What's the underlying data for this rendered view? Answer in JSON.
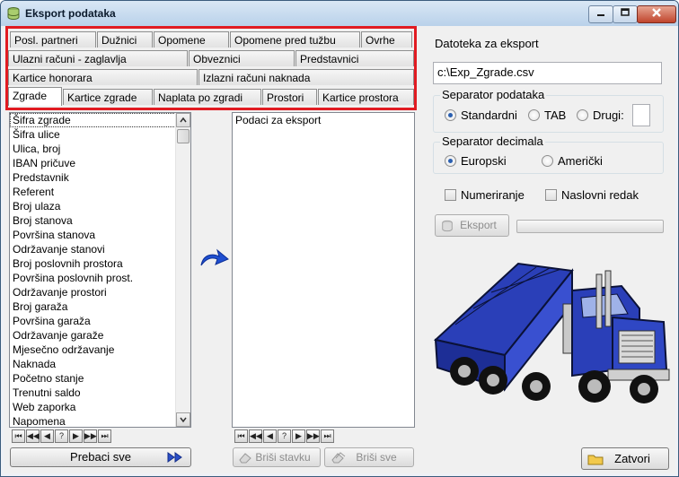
{
  "window": {
    "title": "Eksport podataka"
  },
  "tabs": {
    "row1": [
      "Posl. partneri",
      "Dužnici",
      "Opomene",
      "Opomene pred tužbu",
      "Ovrhe"
    ],
    "row2": [
      "Ulazni računi - zaglavlja",
      "Obveznici",
      "Predstavnici"
    ],
    "row3": [
      "Kartice honorara",
      "Izlazni računi naknada"
    ],
    "row4": [
      "Zgrade",
      "Kartice zgrade",
      "Naplata po zgradi",
      "Prostori",
      "Kartice prostora"
    ],
    "active": "Zgrade"
  },
  "fields_list": {
    "items": [
      "Šifra zgrade",
      "Šifra ulice",
      "Ulica, broj",
      "IBAN pričuve",
      "Predstavnik",
      "Referent",
      "Broj ulaza",
      "Broj stanova",
      "Površina stanova",
      "Održavanje stanovi",
      "Broj poslovnih prostora",
      "Površina poslovnih prost.",
      "Održavanje prostori",
      "Broj garaža",
      "Površina garaža",
      "Održavanje garaže",
      "Mjesečno održavanje",
      "Naknada",
      "Početno stanje",
      "Trenutni saldo",
      "Web zaporka",
      "Napomena"
    ],
    "selected": "Šifra zgrade"
  },
  "export_list": {
    "header": "Podaci za eksport"
  },
  "navigator": {
    "buttons": [
      "⏮",
      "◀◀",
      "◀",
      "?",
      "▶",
      "▶▶",
      "⏭"
    ]
  },
  "buttons": {
    "move_all": "Prebaci sve",
    "move_all_icon": "double-arrow-right-icon",
    "delete_item": "Briši stavku",
    "delete_all": "Briši sve",
    "export": "Eksport",
    "close": "Zatvori"
  },
  "export_file": {
    "label": "Datoteka za eksport",
    "value": "c:\\Exp_Zgrade.csv"
  },
  "data_separator": {
    "label": "Separator podataka",
    "options": [
      "Standardni",
      "TAB",
      "Drugi:"
    ],
    "selected": "Standardni",
    "custom_value": ""
  },
  "decimal_separator": {
    "label": "Separator decimala",
    "options": [
      "Europski",
      "Američki"
    ],
    "selected": "Europski"
  },
  "checkboxes": {
    "numbering": "Numeriranje",
    "header_row": "Naslovni redak"
  },
  "progress": {
    "value": 0
  },
  "colors": {
    "highlight": "#e11b22",
    "truck_blue": "#2a3fb8",
    "arrow": "#1f4fd0"
  }
}
